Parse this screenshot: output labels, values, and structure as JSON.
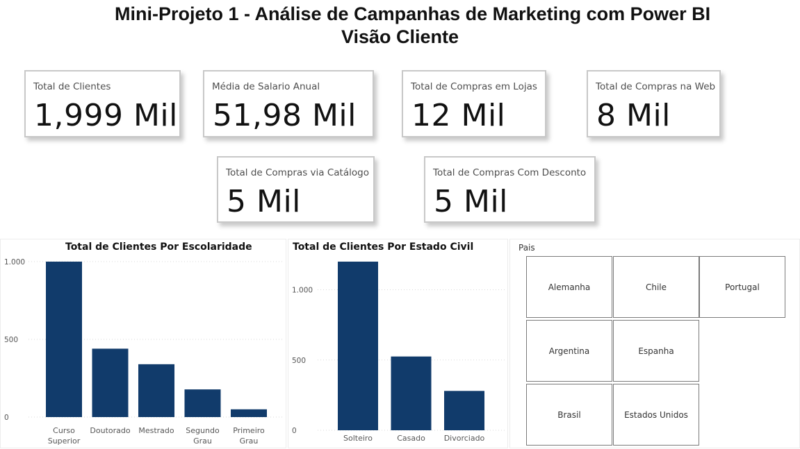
{
  "header": {
    "title_line1": "Mini-Projeto 1 - Análise de Campanhas de Marketing com Power BI",
    "title_line2": "Visão Cliente"
  },
  "kpis": [
    {
      "label": "Total de Clientes",
      "value": "1,999 Mil"
    },
    {
      "label": "Média de Salario Anual",
      "value": "51,98 Mil"
    },
    {
      "label": "Total de Compras em Lojas",
      "value": "12 Mil"
    },
    {
      "label": "Total de Compras na Web",
      "value": "8 Mil"
    },
    {
      "label": "Total de Compras via Catálogo",
      "value": "5 Mil"
    },
    {
      "label": "Total de Compras Com Desconto",
      "value": "5 Mil"
    }
  ],
  "chart_data": [
    {
      "type": "bar",
      "title": "Total de Clientes Por Escolaridade",
      "categories": [
        [
          "Curso",
          "Superior"
        ],
        [
          "Doutorado"
        ],
        [
          "Mestrado"
        ],
        [
          "Segundo",
          "Grau"
        ],
        [
          "Primeiro",
          "Grau"
        ]
      ],
      "values": [
        1000,
        440,
        340,
        178,
        50
      ],
      "ylim": [
        0,
        1000
      ],
      "yticks": [
        0,
        500,
        1000
      ],
      "ytick_labels": [
        "0",
        "500",
        "1.000"
      ],
      "color": "#113b6b",
      "grid": true
    },
    {
      "type": "bar",
      "title": "Total de Clientes Por Estado Civil",
      "categories": [
        [
          "Solteiro"
        ],
        [
          "Casado"
        ],
        [
          "Divorciado"
        ]
      ],
      "values": [
        1200,
        525,
        280
      ],
      "ylim": [
        0,
        1200
      ],
      "yticks": [
        0,
        500,
        1000
      ],
      "ytick_labels": [
        "0",
        "500",
        "1.000"
      ],
      "color": "#113b6b",
      "grid": true
    }
  ],
  "slicer": {
    "title": "Pais",
    "options": [
      "Alemanha",
      "Chile",
      "Portugal",
      "Argentina",
      "Espanha",
      "Brasil",
      "Estados Unidos"
    ]
  }
}
